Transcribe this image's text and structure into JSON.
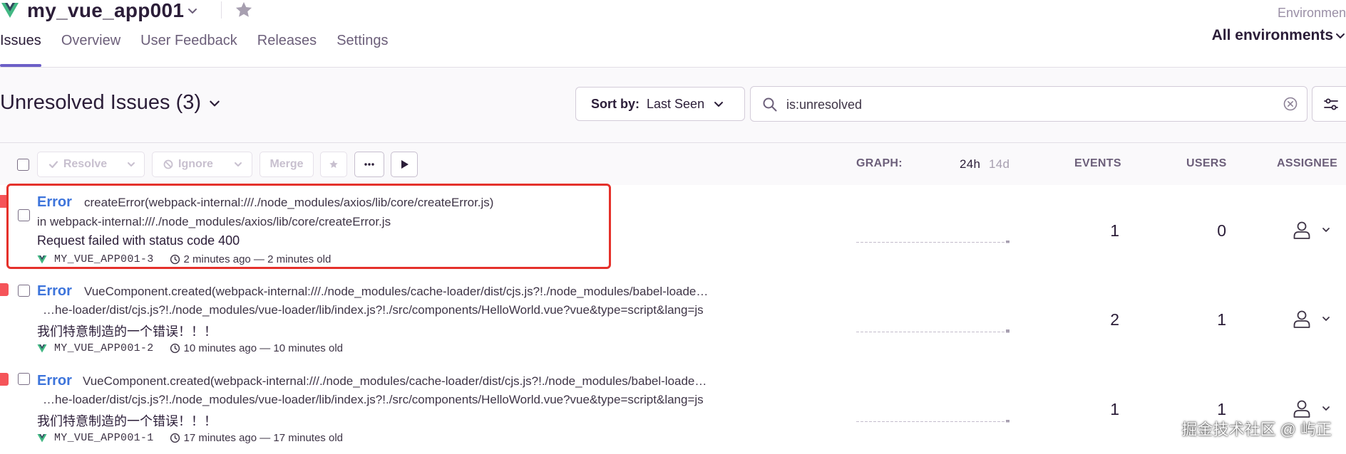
{
  "header": {
    "project_name": "my_vue_app001",
    "tabs": [
      "Issues",
      "Overview",
      "User Feedback",
      "Releases",
      "Settings"
    ],
    "environment_label": "Environmen",
    "environment_value": "All environments"
  },
  "title": {
    "text": "Unresolved Issues (3)"
  },
  "sort": {
    "label": "Sort by:",
    "value": "Last Seen"
  },
  "search": {
    "query": "is:unresolved"
  },
  "toolbar": {
    "resolve": "Resolve",
    "ignore": "Ignore",
    "merge": "Merge"
  },
  "columns": {
    "graph": "GRAPH:",
    "range_24h": "24h",
    "range_14d": "14d",
    "events": "EVENTS",
    "users": "USERS",
    "assignee": "ASSIGNEE"
  },
  "issues": [
    {
      "level": "Error",
      "title": "createError(webpack-internal:///./node_modules/axios/lib/core/createError.js)",
      "subtitle": "in webpack-internal:///./node_modules/axios/lib/core/createError.js",
      "message": "Request failed with status code 400",
      "short_id": "MY_VUE_APP001-3",
      "time": "2 minutes ago — 2 minutes old",
      "events": "1",
      "users": "0"
    },
    {
      "level": "Error",
      "title": "VueComponent.created(webpack-internal:///./node_modules/cache-loader/dist/cjs.js?!./node_modules/babel-loade…",
      "subtitle": "…he-loader/dist/cjs.js?!./node_modules/vue-loader/lib/index.js?!./src/components/HelloWorld.vue?vue&type=script&lang=js",
      "message": "我们特意制造的一个错误！！！",
      "short_id": "MY_VUE_APP001-2",
      "time": "10 minutes ago — 10 minutes old",
      "events": "2",
      "users": "1"
    },
    {
      "level": "Error",
      "title": "VueComponent.created(webpack-internal:///./node_modules/cache-loader/dist/cjs.js?!./node_modules/babel-loade…",
      "subtitle": "…he-loader/dist/cjs.js?!./node_modules/vue-loader/lib/index.js?!./src/components/HelloWorld.vue?vue&type=script&lang=js",
      "message": "我们特意制造的一个错误！！！",
      "short_id": "MY_VUE_APP001-1",
      "time": "17 minutes ago — 17 minutes old",
      "events": "1",
      "users": "1"
    }
  ],
  "watermark": "掘金技术社区 @ 屿正",
  "icons": {
    "project": "vue-logo-icon",
    "bookmark": "star-icon",
    "search": "search-icon",
    "clear": "clear-search-icon",
    "filter": "filter-sliders-icon",
    "more": "more-icon",
    "play": "play-icon",
    "assignee": "user-icon",
    "time": "clock-icon"
  },
  "colors": {
    "accent": "#6c5fc7",
    "error_level": "#3d74db",
    "error_bar": "#f55459",
    "highlight": "#e5312b"
  }
}
